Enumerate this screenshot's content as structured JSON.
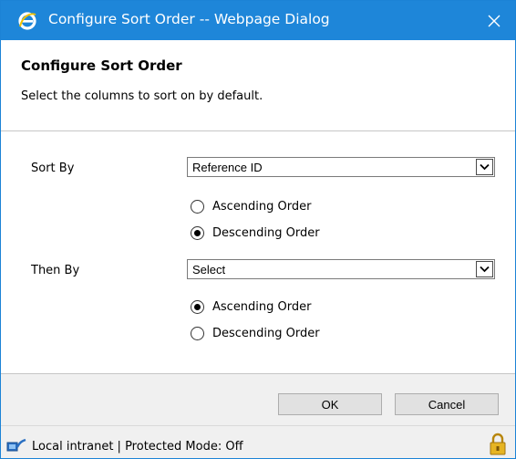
{
  "window": {
    "title": "Configure Sort Order -- Webpage Dialog",
    "accent_color": "#1e86d9"
  },
  "header": {
    "title": "Configure Sort Order",
    "subtitle": "Select the columns to sort on by default."
  },
  "sort_by": {
    "label": "Sort By",
    "selected": "Reference ID",
    "options": [
      {
        "label": "Ascending Order",
        "checked": false
      },
      {
        "label": "Descending Order",
        "checked": true
      }
    ]
  },
  "then_by": {
    "label": "Then By",
    "selected": "Select",
    "options": [
      {
        "label": "Ascending Order",
        "checked": true
      },
      {
        "label": "Descending Order",
        "checked": false
      }
    ]
  },
  "buttons": {
    "ok": "OK",
    "cancel": "Cancel"
  },
  "status": {
    "text": "Local intranet | Protected Mode: Off",
    "icons": [
      "local-intranet-icon",
      "lock-icon"
    ]
  }
}
